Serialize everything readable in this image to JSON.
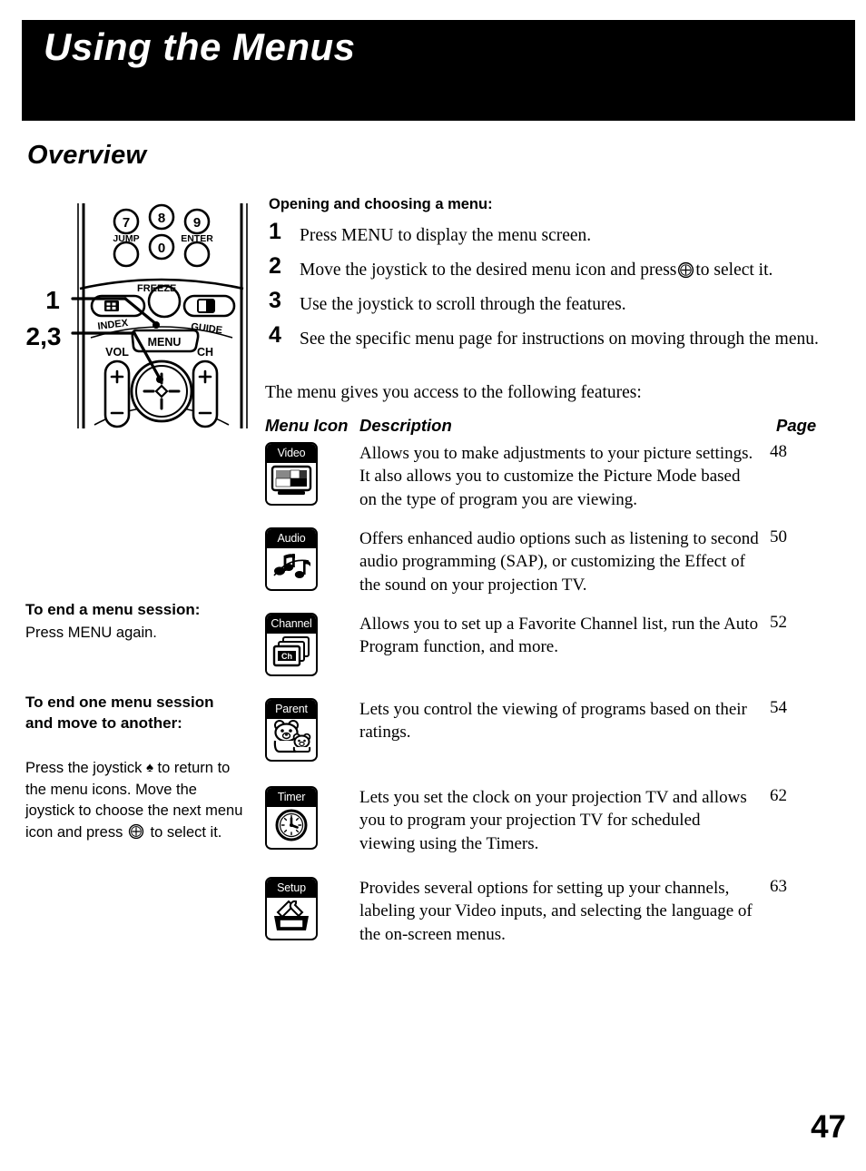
{
  "header": {
    "title": "Using the Menus"
  },
  "section": {
    "heading": "Overview"
  },
  "remote": {
    "labels": {
      "key7": "7",
      "key8": "8",
      "key9": "9",
      "key0": "0",
      "jump": "JUMP",
      "enter": "ENTER",
      "freeze": "FREEZE",
      "index": "INDEX",
      "guide": "GUIDE",
      "menu": "MENU",
      "vol": "VOL",
      "ch": "CH",
      "plus": "+",
      "minus": "–"
    },
    "callouts": {
      "one": "1",
      "two_three": "2,3"
    }
  },
  "steps": {
    "heading": "Opening and choosing a menu:",
    "items": [
      {
        "num": "1",
        "text": "Press MENU to display the menu screen."
      },
      {
        "num": "2",
        "text_before": "Move the joystick to the desired menu icon and press",
        "text_after": "to select it."
      },
      {
        "num": "3",
        "text": "Use the joystick to scroll through the features."
      },
      {
        "num": "4",
        "text": "See the specific menu page for instructions on moving through the menu."
      }
    ],
    "lead_in": "The menu gives you access to the following features:"
  },
  "notes": [
    {
      "heading": "To end a menu session:",
      "body": "Press MENU again."
    },
    {
      "heading": "To end one menu session and move to another:",
      "body_part1": "Press the joystick",
      "body_part2": "to return to the menu icons. Move the joystick to choose the next menu icon and press",
      "body_part3": "to select it."
    }
  ],
  "table": {
    "headers": {
      "icon": "Menu Icon",
      "description": "Description",
      "page": "Page"
    },
    "rows": [
      {
        "icon_label": "Video",
        "icon_name": "video-menu-icon",
        "description": "Allows you to make adjustments to your picture settings. It also allows you to customize the Picture Mode based on the type of program you are viewing.",
        "page": "48"
      },
      {
        "icon_label": "Audio",
        "icon_name": "audio-menu-icon",
        "description": "Offers enhanced audio options such as listening to second audio programming (SAP), or customizing the Effect of the sound on your projection TV.",
        "page": "50"
      },
      {
        "icon_label": "Channel",
        "icon_name": "channel-menu-icon",
        "description": "Allows you to set up a Favorite Channel list, run the Auto Program function, and more.",
        "page": "52"
      },
      {
        "icon_label": "Parent",
        "icon_name": "parent-menu-icon",
        "description": "Lets you control the viewing of programs based on their ratings.",
        "page": "54"
      },
      {
        "icon_label": "Timer",
        "icon_name": "timer-menu-icon",
        "description": "Lets you set the clock on your projection TV and allows you to program your projection TV for scheduled viewing using the Timers.",
        "page": "62"
      },
      {
        "icon_label": "Setup",
        "icon_name": "setup-menu-icon",
        "description": "Provides several options for  setting up your channels, labeling your Video inputs, and selecting the language of the on-screen menus.",
        "page": "63"
      }
    ]
  },
  "footer": {
    "page_number": "47"
  },
  "colors": {
    "ink": "#000000",
    "paper": "#ffffff"
  }
}
